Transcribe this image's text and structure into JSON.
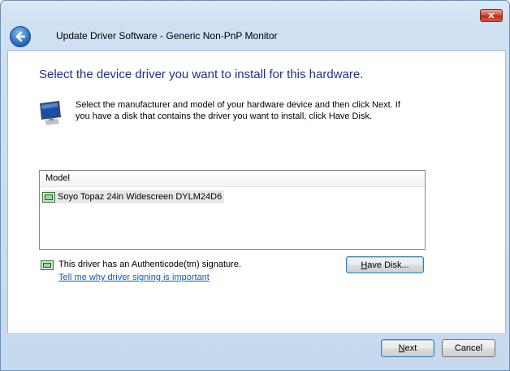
{
  "window": {
    "title": "Update Driver Software - Generic Non-PnP Monitor",
    "close_glyph": "✕"
  },
  "content": {
    "heading": "Select the device driver you want to install for this hardware.",
    "instruction": "Select the manufacturer and model of your hardware device and then click Next. If you have a disk that contains the driver you want to install, click Have Disk.",
    "list": {
      "column_header": "Model",
      "items": [
        "Soyo Topaz 24in Widescreen DYLM24D6"
      ]
    },
    "signature_text": "This driver has an Authenticode(tm) signature.",
    "signature_link": "Tell me why driver signing is important",
    "have_disk_label_prefix": "H",
    "have_disk_label_rest": "ave Disk..."
  },
  "footer": {
    "next_label_prefix": "N",
    "next_label_rest": "ext",
    "cancel_label": "Cancel"
  },
  "icons": {
    "back": "back-arrow-icon",
    "monitor": "monitor-icon",
    "driver": "driver-board-icon",
    "close": "close-icon"
  }
}
